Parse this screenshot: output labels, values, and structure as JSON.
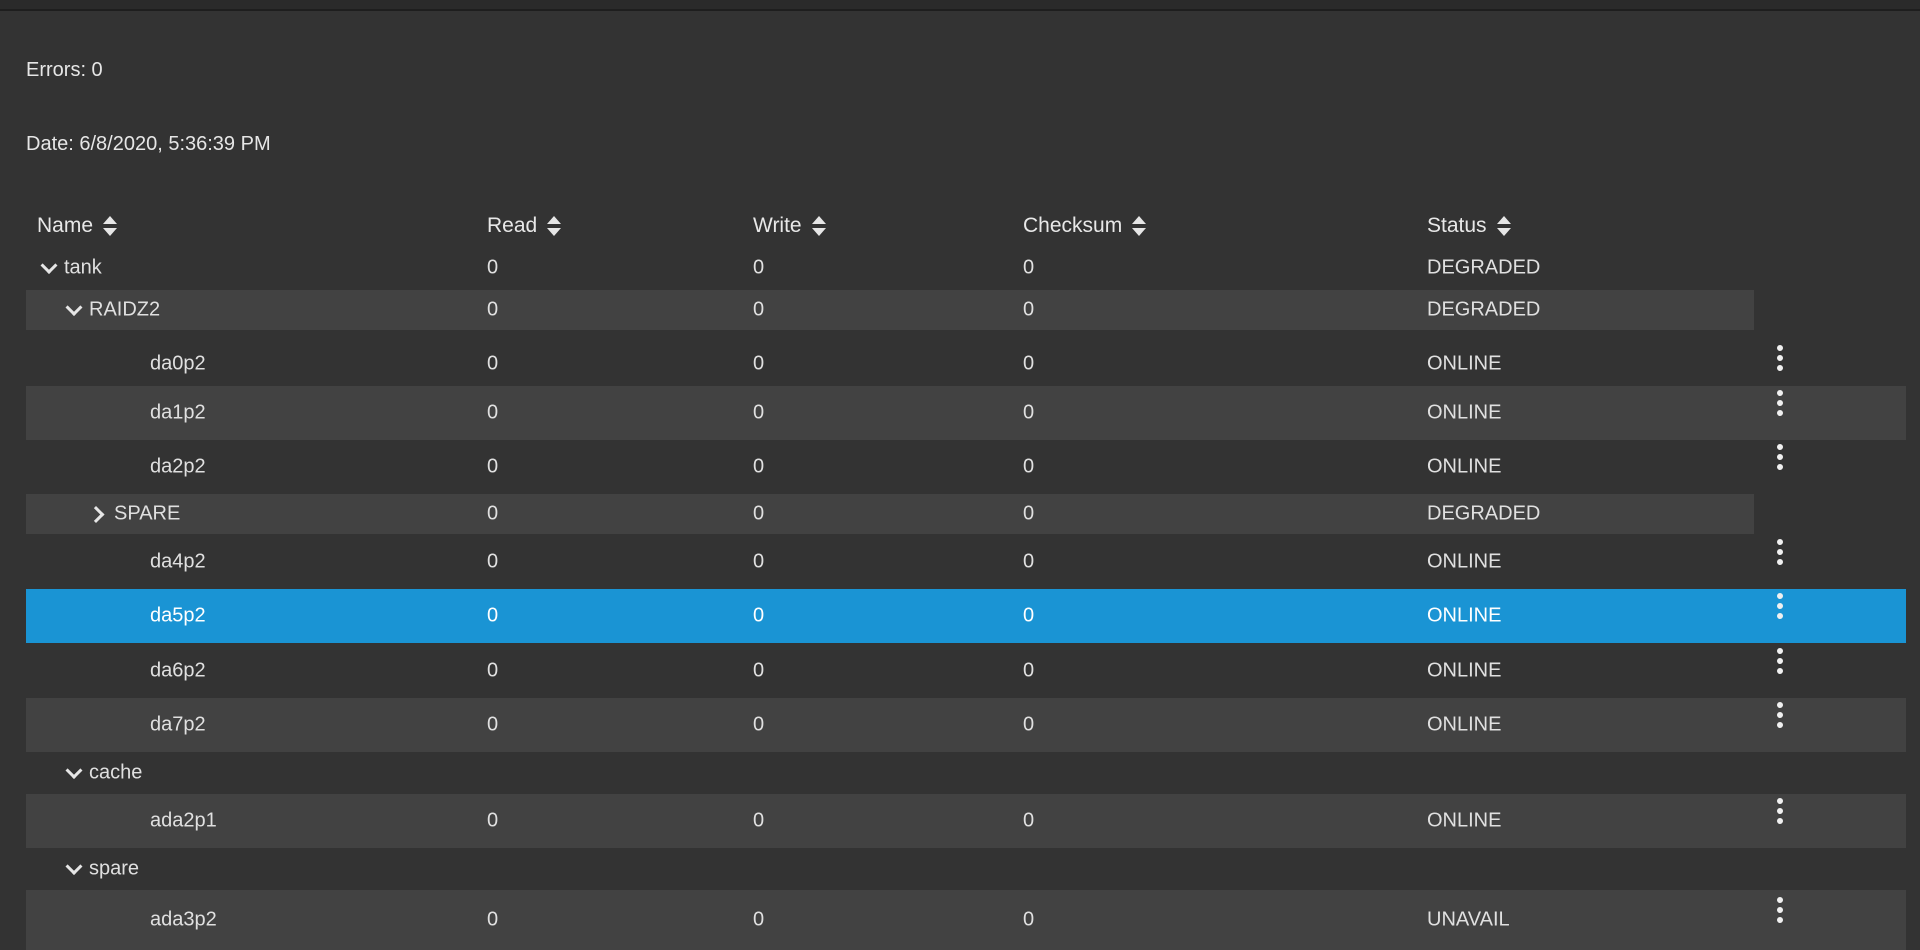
{
  "info": {
    "errors": "Errors: 0",
    "date": "Date: 6/8/2020, 5:36:39 PM"
  },
  "columns": [
    "Name",
    "Read",
    "Write",
    "Checksum",
    "Status"
  ],
  "rows": [
    {
      "name": "tank",
      "read": "0",
      "write": "0",
      "checksum": "0",
      "status": "DEGRADED",
      "level": 0,
      "expander": "down",
      "menu": false
    },
    {
      "name": "RAIDZ2",
      "read": "0",
      "write": "0",
      "checksum": "0",
      "status": "DEGRADED",
      "level": 1,
      "expander": "down",
      "menu": false
    },
    {
      "name": "da0p2",
      "read": "0",
      "write": "0",
      "checksum": "0",
      "status": "ONLINE",
      "level": 2,
      "expander": null,
      "menu": true
    },
    {
      "name": "da1p2",
      "read": "0",
      "write": "0",
      "checksum": "0",
      "status": "ONLINE",
      "level": 2,
      "expander": null,
      "menu": true
    },
    {
      "name": "da2p2",
      "read": "0",
      "write": "0",
      "checksum": "0",
      "status": "ONLINE",
      "level": 2,
      "expander": null,
      "menu": true
    },
    {
      "name": "SPARE",
      "read": "0",
      "write": "0",
      "checksum": "0",
      "status": "DEGRADED",
      "level": 2,
      "expander": "right",
      "menu": false
    },
    {
      "name": "da4p2",
      "read": "0",
      "write": "0",
      "checksum": "0",
      "status": "ONLINE",
      "level": 2,
      "expander": null,
      "menu": true
    },
    {
      "name": "da5p2",
      "read": "0",
      "write": "0",
      "checksum": "0",
      "status": "ONLINE",
      "level": 2,
      "expander": null,
      "menu": true,
      "selected": true
    },
    {
      "name": "da6p2",
      "read": "0",
      "write": "0",
      "checksum": "0",
      "status": "ONLINE",
      "level": 2,
      "expander": null,
      "menu": true
    },
    {
      "name": "da7p2",
      "read": "0",
      "write": "0",
      "checksum": "0",
      "status": "ONLINE",
      "level": 2,
      "expander": null,
      "menu": true
    },
    {
      "name": "cache",
      "read": "",
      "write": "",
      "checksum": "",
      "status": "",
      "level": 1,
      "expander": "down",
      "menu": false
    },
    {
      "name": "ada2p1",
      "read": "0",
      "write": "0",
      "checksum": "0",
      "status": "ONLINE",
      "level": 2,
      "expander": null,
      "menu": true
    },
    {
      "name": "spare",
      "read": "",
      "write": "",
      "checksum": "",
      "status": "",
      "level": 1,
      "expander": "down",
      "menu": false
    },
    {
      "name": "ada3p2",
      "read": "0",
      "write": "0",
      "checksum": "0",
      "status": "UNAVAIL",
      "level": 2,
      "expander": null,
      "menu": true
    }
  ]
}
